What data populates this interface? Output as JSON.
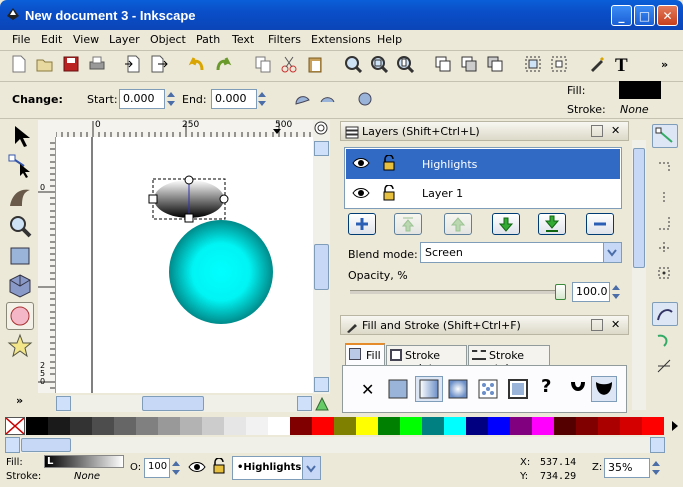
{
  "window": {
    "title": "New document 3 - Inkscape"
  },
  "menu": [
    "File",
    "Edit",
    "View",
    "Layer",
    "Object",
    "Path",
    "Text",
    "Filters",
    "Extensions",
    "Help"
  ],
  "controls": {
    "change_label": "Change:",
    "start_label": "Start:",
    "start_value": "0.000",
    "end_label": "End:",
    "end_value": "0.000",
    "fill_label": "Fill:",
    "stroke_label": "Stroke:",
    "stroke_value": "None"
  },
  "ruler": {
    "top_ticks": [
      "0",
      "250",
      "500"
    ],
    "left_ticks": [
      "0",
      "2",
      "5",
      "0"
    ]
  },
  "layers_panel": {
    "title": "Layers (Shift+Ctrl+L)",
    "layers": [
      {
        "name": "Highlights",
        "selected": true
      },
      {
        "name": "Layer 1",
        "selected": false
      }
    ],
    "blend_label": "Blend mode:",
    "blend_value": "Screen",
    "opacity_label": "Opacity, %",
    "opacity_value": "100.0"
  },
  "fill_panel": {
    "title": "Fill and Stroke (Shift+Ctrl+F)",
    "tabs": [
      "Fill",
      "Stroke paint",
      "Stroke style"
    ],
    "paint_icons": [
      "no-paint",
      "flat-color",
      "linear-gradient",
      "radial-gradient",
      "pattern",
      "swatch",
      "unset",
      "evenodd",
      "nonzero"
    ],
    "unset_glyph": "?"
  },
  "palette": [
    "#000000",
    "#1a1a1a",
    "#333333",
    "#4d4d4d",
    "#666666",
    "#808080",
    "#999999",
    "#b3b3b3",
    "#cccccc",
    "#e6e6e6",
    "#f2f2f2",
    "#ffffff",
    "#800000",
    "#ff0000",
    "#808000",
    "#ffff00",
    "#008000",
    "#00ff00",
    "#008080",
    "#00ffff",
    "#000080",
    "#0000ff",
    "#800080",
    "#ff00ff",
    "#550000",
    "#800000",
    "#aa0000",
    "#d40000",
    "#ff0000"
  ],
  "status": {
    "fill_label": "Fill:",
    "fill_swatch": "L",
    "stroke_label": "Stroke:",
    "stroke_value": "None",
    "opacity_label": "O:",
    "opacity_value": "100",
    "layer_value": "•Highlights",
    "x_label": "X:",
    "x_value": "537.14",
    "y_label": "Y:",
    "y_value": "734.29",
    "zoom_label": "Z:",
    "zoom_value": "35%"
  }
}
